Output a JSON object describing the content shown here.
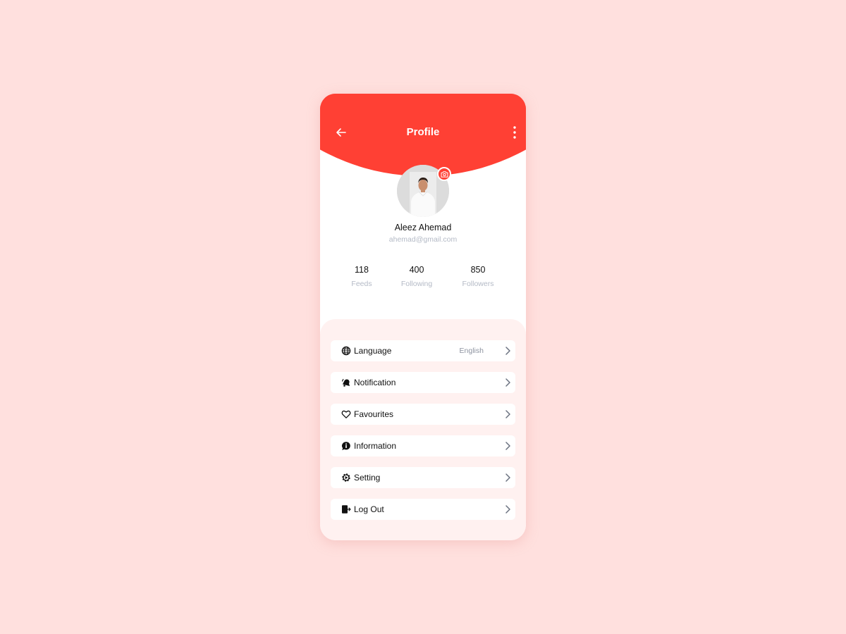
{
  "header": {
    "title": "Profile",
    "back_icon": "arrow-left-icon",
    "menu_icon": "more-vertical-icon",
    "color": "#ff4034"
  },
  "profile": {
    "name": "Aleez Ahemad",
    "email": "ahemad@gmail.com",
    "camera_icon": "camera-icon"
  },
  "stats": [
    {
      "value": "118",
      "label": "Feeds"
    },
    {
      "value": "400",
      "label": "Following"
    },
    {
      "value": "850",
      "label": "Followers"
    }
  ],
  "menu": [
    {
      "label": "Language",
      "value": "English",
      "icon": "globe-icon"
    },
    {
      "label": "Notification",
      "value": "",
      "icon": "bell-icon"
    },
    {
      "label": "Favourites",
      "value": "",
      "icon": "heart-icon"
    },
    {
      "label": "Information",
      "value": "",
      "icon": "info-bubble-icon"
    },
    {
      "label": "Setting",
      "value": "",
      "icon": "gear-icon"
    },
    {
      "label": "Log Out",
      "value": "",
      "icon": "logout-icon"
    }
  ]
}
